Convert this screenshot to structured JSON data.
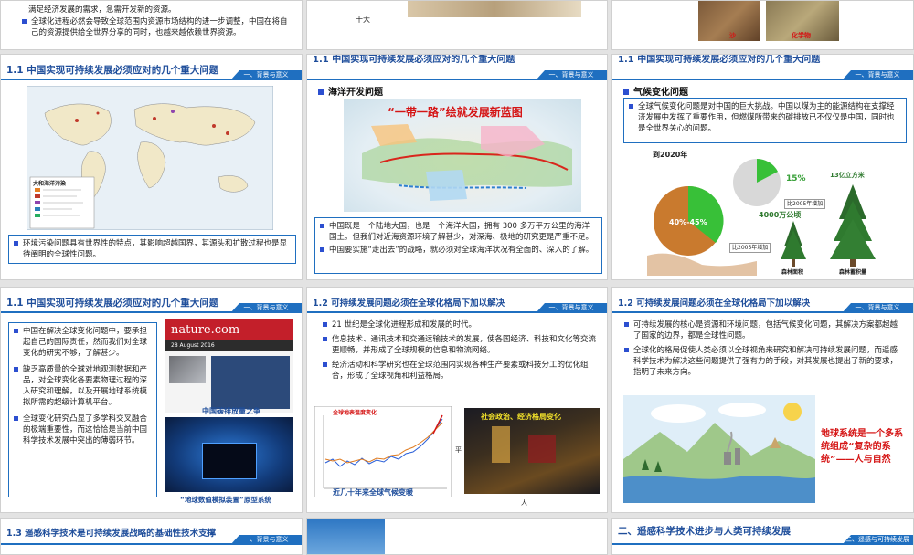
{
  "r1": {
    "s1_text": "满足经济发展的需求，急需开发新的资源。",
    "s1_bullet": "全球化进程必然会导致全球范围内资源市场结构的进一步调整，中国在将自己的资源提供给全世界分享的同时，也越来越依赖世界资源。",
    "s2_label": "十大",
    "s3_tag1": "沙",
    "s3_tag2": "化学物"
  },
  "s4": {
    "title": "1.1 中国实现可持续发展必须应对的几个重大问题",
    "tag": "一、背景与意义",
    "legend_title": "大和海洋污染",
    "text": "环境污染问题具有世界性的特点，其影响超越国界，其源头和扩散过程也是显待阐明的全球性问题。"
  },
  "s5": {
    "title": "1.1 中国实现可持续发展必须应对的几个重大问题",
    "tag": "一、背景与意义",
    "subheading": "海洋开发问题",
    "map_title": "“一带一路”绘就发展新蓝图",
    "bullets": [
      "中国既是一个陆地大国，也是一个海洋大国，拥有 300 多万平方公里的海洋国土。但我们对近海资源环境了解甚少，对深海、极地的研究更是严重不足。",
      "中国要实施“走出去”的战略，就必须对全球海洋状况有全面的、深入的了解。"
    ]
  },
  "s6": {
    "title": "1.1 中国实现可持续发展必须应对的几个重大问题",
    "tag": "一、背景与意义",
    "subheading": "气候变化问题",
    "text": "全球气候变化问题是对中国的巨大挑战。中国以煤为主的能源结构在支撑经济发展中发挥了重要作用，但燃煤所带来的碳排放已不仅仅是中国，同时也是全世界关心的问题。",
    "info_year": "到2020年",
    "pie_label": "40%-45%",
    "pct": "15%",
    "vol": "13亿立方米",
    "area": "4000万公顷",
    "note1": "比2005年增加",
    "note2": "比2005年增加",
    "tree1": "森林面积",
    "tree2": "森林蓄积量"
  },
  "s7": {
    "title": "1.1 中国实现可持续发展必须应对的几个重大问题",
    "tag": "一、背景与意义",
    "bullets": [
      "中国在解决全球变化问题中，要承担起自己的国际责任，然而我们对全球变化的研究不够，了解甚少。",
      "缺乏高质量的全球对地观测数据和产品，对全球变化各要素物理过程的深入研究和理解，以及开展地球系统模拟所需的超级计算机平台。",
      "全球变化研究凸显了多学科交叉融合的极端重要性，而这恰恰是当前中国科学技术发展中突出的薄弱环节。"
    ],
    "nature_logo": "nature.com",
    "nature_date": "28 August 2016",
    "photo_caption": "中国碳排放量之争",
    "caption": "“地球数值模拟装置”原型系统"
  },
  "s8": {
    "title": "1.2 可持续发展问题必须在全球化格局下加以解决",
    "tag": "一、背景与意义",
    "bullets": [
      "21 世纪是全球化进程形成和发展的时代。",
      "信息技术、通讯技术和交通运输技术的发展，使各国经济、科技和文化等交流更顺畅，并形成了全球规模的信息和物流网络。",
      "经济活动和科学研究也在全球范围内实现各种生产要素或科技分工的优化组合，形成了全球视角和利益格局。"
    ],
    "chart_title": "全球地表温度变化",
    "chart_caption": "近几十年来全球气候变暖",
    "photo_title": "社会政治、经济格局变化",
    "axis_x": "人",
    "axis_y": "平"
  },
  "s9": {
    "title": "1.2 可持续发展问题必须在全球化格局下加以解决",
    "tag": "一、背景与意义",
    "bullets": [
      "可持续发展的核心是资源和环境问题，包括气候变化问题，其解决方案都超越了国家的边界，都是全球性问题。",
      "全球化的格局促使人类必须以全球视角来研究和解决可持续发展问题，而遥感科学技术为解决这些问题提供了强有力的手段，对其发展也提出了新的要求，指明了未来方向。"
    ],
    "callout": "地球系统是一个多系统组成“复杂的系统”——人与自然"
  },
  "r4": {
    "s10_title": "1.3 遥感科学技术是可持续发展战略的基础性技术支撑",
    "s10_tag": "一、背景与意义",
    "s12_title": "二、遥感科学技术进步与人类可持续发展",
    "s12_tag": "二、遥感与可持续发展"
  },
  "colors": {
    "accent": "#1f6fc0",
    "title": "#1f4e9b",
    "bullet": "#2c4fd0",
    "red": "#d51515"
  }
}
